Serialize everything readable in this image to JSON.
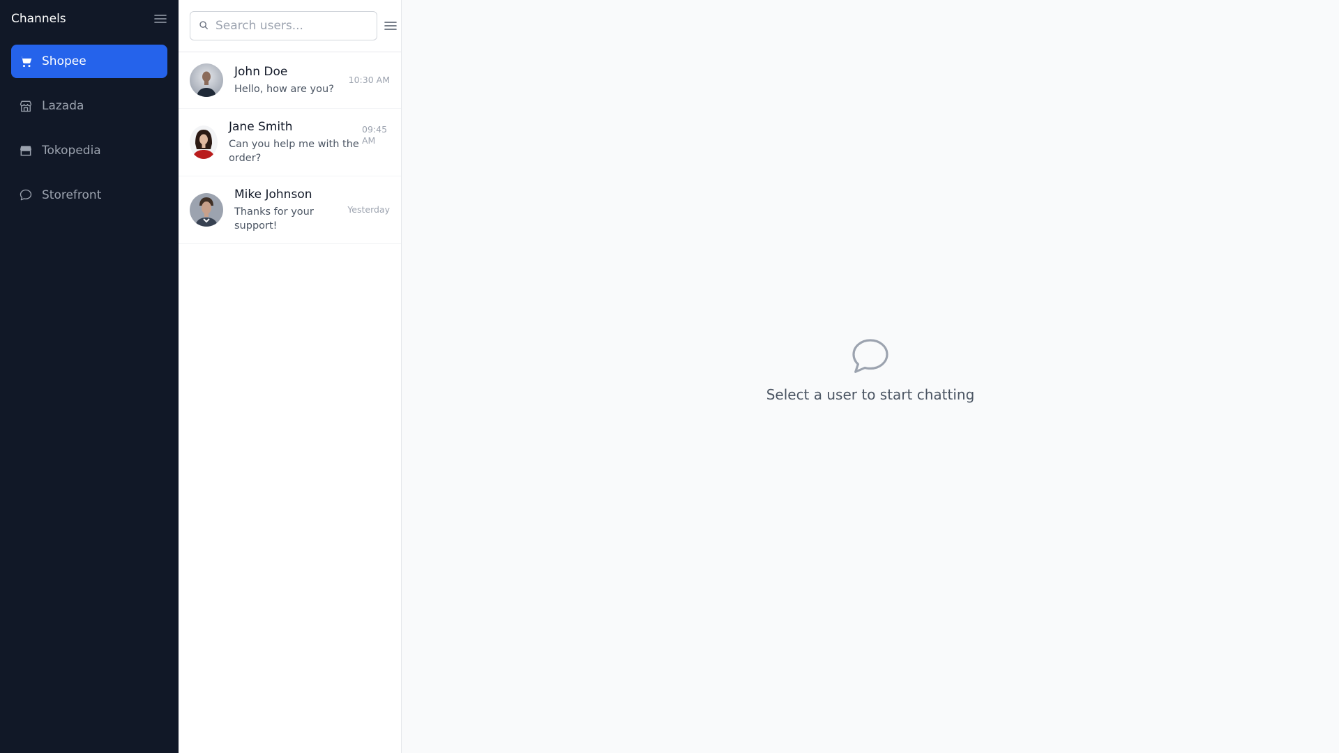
{
  "sidebar": {
    "title": "Channels",
    "menu_icon": "hamburger-icon",
    "items": [
      {
        "label": "Shopee",
        "icon": "cart-icon",
        "active": true
      },
      {
        "label": "Lazada",
        "icon": "store-icon",
        "active": false
      },
      {
        "label": "Tokopedia",
        "icon": "shop-icon",
        "active": false
      },
      {
        "label": "Storefront",
        "icon": "chat-bubble-icon",
        "active": false
      }
    ]
  },
  "userlist": {
    "search_placeholder": "Search users...",
    "search_value": "",
    "users": [
      {
        "name": "John Doe",
        "message": "Hello, how are you?",
        "time": "10:30 AM"
      },
      {
        "name": "Jane Smith",
        "message": "Can you help me with the order?",
        "time": "09:45 AM"
      },
      {
        "name": "Mike Johnson",
        "message": "Thanks for your support!",
        "time": "Yesterday"
      }
    ]
  },
  "main": {
    "empty_text": "Select a user to start chatting",
    "empty_icon": "chat-bubble-icon"
  },
  "colors": {
    "sidebar_bg": "#111827",
    "accent": "#2563eb",
    "main_bg": "#f9fafb"
  }
}
